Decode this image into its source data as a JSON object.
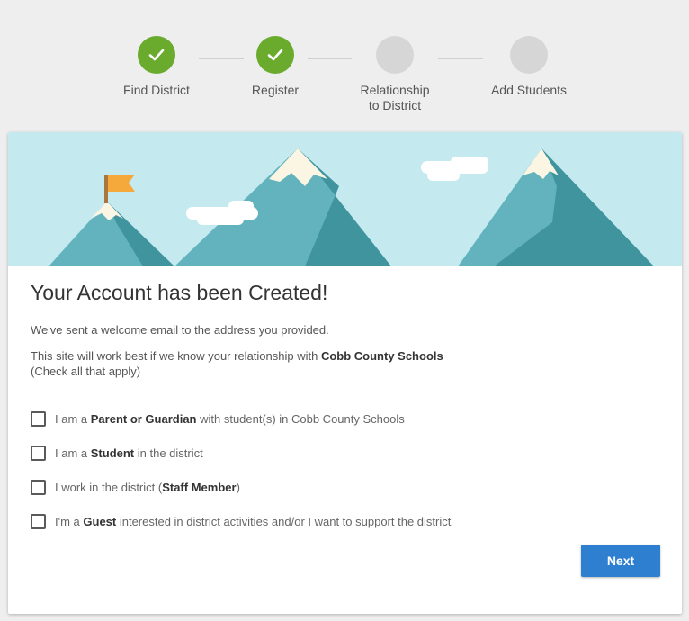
{
  "stepper": {
    "steps": [
      {
        "label": "Find District",
        "status": "done"
      },
      {
        "label": "Register",
        "status": "done"
      },
      {
        "label_line1": "Relationship",
        "label_line2": "to District",
        "status": "todo"
      },
      {
        "label": "Add Students",
        "status": "todo"
      }
    ]
  },
  "colors": {
    "step_done": "#6aaa2c",
    "step_todo": "#d6d6d6",
    "banner_sky": "#c4e9ef",
    "mountain_light": "#62b3bd",
    "mountain_dark": "#3f949e",
    "flag": "#f5a93b",
    "next_button": "#2f7fd1"
  },
  "card": {
    "title": "Your Account has been Created!",
    "welcome_text": "We've sent a welcome email to the address you provided.",
    "relationship_prefix": "This site will work best if we know your relationship with ",
    "district_name": "Cobb County Schools",
    "check_hint": "(Check all that apply)",
    "options": [
      {
        "pre": "I am a ",
        "bold": "Parent or Guardian",
        "post": " with student(s) in Cobb County Schools",
        "checked": false
      },
      {
        "pre": "I am a ",
        "bold": "Student",
        "post": " in the district",
        "checked": false
      },
      {
        "pre": "I work in the district (",
        "bold": "Staff Member",
        "post": ")",
        "checked": false
      },
      {
        "pre": "I'm a ",
        "bold": "Guest",
        "post": " interested in district activities and/or I want to support the district",
        "checked": false
      }
    ],
    "next_label": "Next"
  }
}
